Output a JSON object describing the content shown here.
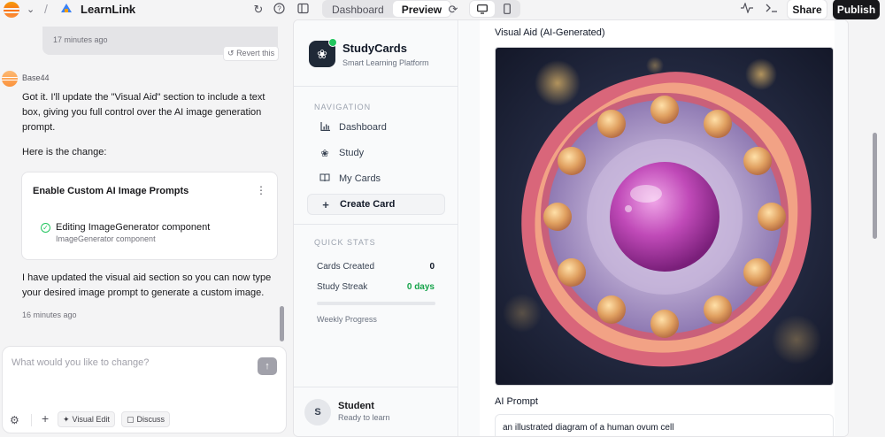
{
  "topbar": {
    "project_name": "LearnLink",
    "view_tabs": [
      "Dashboard",
      "Preview"
    ],
    "active_tab": "Preview",
    "share_label": "Share",
    "publish_label": "Publish"
  },
  "chat": {
    "prev_time": "17 minutes ago",
    "revert_label": "Revert this",
    "author": "Base44",
    "message_intro": "Got it. I'll update the \"Visual Aid\" section to include a text box, giving you full control over the AI image generation prompt.",
    "message_change": "Here is the change:",
    "task": {
      "title": "Enable Custom AI Image Prompts",
      "item": "Editing ImageGenerator component",
      "item_sub": "ImageGenerator component"
    },
    "message_done": "I have updated the visual aid section so you can now type your desired image prompt to generate a custom image.",
    "time": "16 minutes ago",
    "input_placeholder": "What would you like to change?",
    "visual_edit_label": "Visual Edit",
    "discuss_label": "Discuss"
  },
  "app": {
    "brand_name": "StudyCards",
    "brand_tagline": "Smart Learning Platform",
    "nav_heading": "NAVIGATION",
    "nav": [
      {
        "label": "Dashboard",
        "icon": "bar-chart-icon"
      },
      {
        "label": "Study",
        "icon": "brain-icon"
      },
      {
        "label": "My Cards",
        "icon": "book-icon"
      },
      {
        "label": "Create Card",
        "icon": "plus-icon"
      }
    ],
    "active_nav": "Create Card",
    "stats_heading": "QUICK STATS",
    "stats": [
      {
        "label": "Cards Created",
        "value": "0",
        "color": "#111827"
      },
      {
        "label": "Study Streak",
        "value": "0 days",
        "color": "#16a34a"
      }
    ],
    "progress_label": "Weekly Progress",
    "progress_fraction": 0,
    "user_initial": "S",
    "user_name": "Student",
    "user_status": "Ready to learn",
    "visual_aid_label": "Visual Aid (AI-Generated)",
    "ai_prompt_label": "AI Prompt",
    "ai_prompt_value": "an illustrated diagram of a human ovum cell"
  }
}
